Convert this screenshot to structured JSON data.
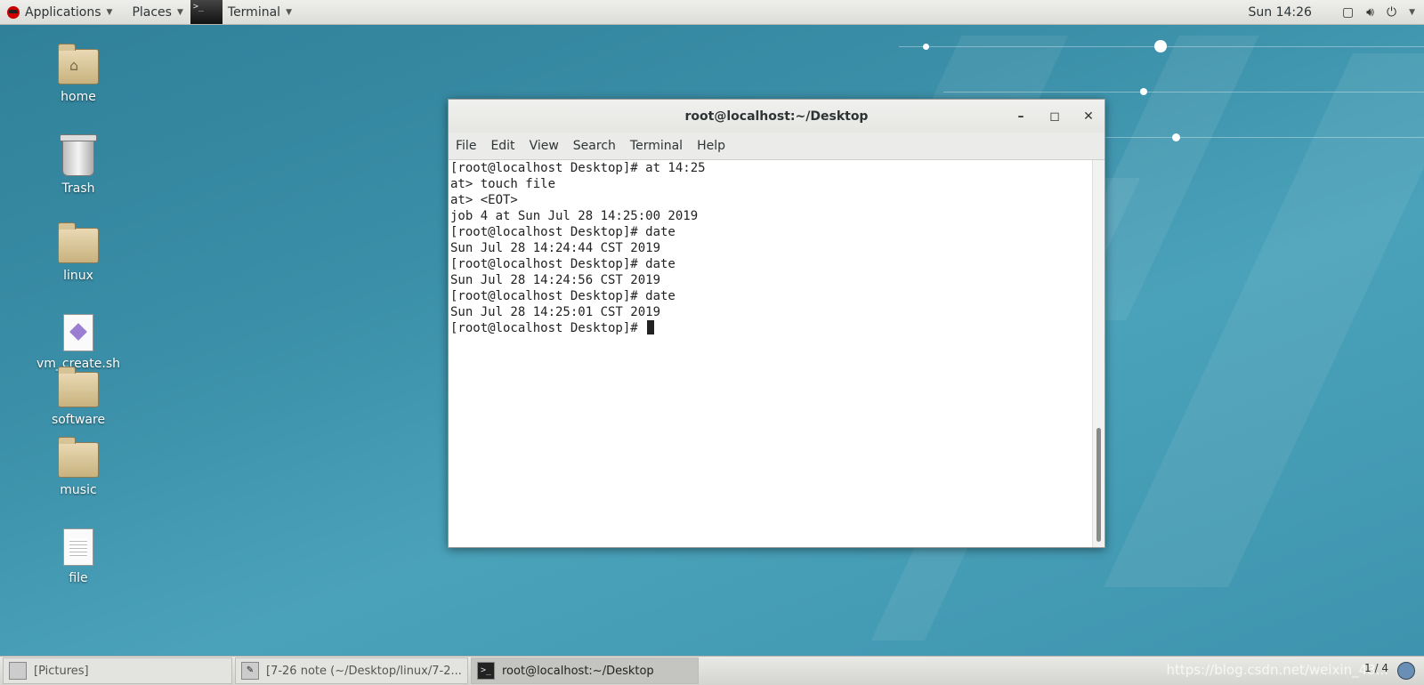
{
  "top_panel": {
    "applications": "Applications",
    "places": "Places",
    "terminal": "Terminal",
    "clock": "Sun 14:26",
    "icons": [
      "screen-icon",
      "volume-icon",
      "power-icon"
    ]
  },
  "desktop_icons": [
    {
      "label": "home"
    },
    {
      "label": "Trash"
    },
    {
      "label": "linux"
    },
    {
      "label": "vm_create.sh"
    },
    {
      "label": "software"
    },
    {
      "label": "music"
    },
    {
      "label": "file"
    }
  ],
  "terminal": {
    "title": "root@localhost:~/Desktop",
    "menu": [
      "File",
      "Edit",
      "View",
      "Search",
      "Terminal",
      "Help"
    ],
    "lines": [
      "[root@localhost Desktop]# at 14:25",
      "at> touch file",
      "at> <EOT>",
      "job 4 at Sun Jul 28 14:25:00 2019",
      "[root@localhost Desktop]# date",
      "Sun Jul 28 14:24:44 CST 2019",
      "[root@localhost Desktop]# date",
      "Sun Jul 28 14:24:56 CST 2019",
      "[root@localhost Desktop]# date",
      "Sun Jul 28 14:25:01 CST 2019",
      "[root@localhost Desktop]# "
    ]
  },
  "taskbar": {
    "items": [
      {
        "label": "[Pictures]"
      },
      {
        "label": "[7-26 note (~/Desktop/linux/7-2..."
      },
      {
        "label": "root@localhost:~/Desktop"
      }
    ],
    "workspace": "1 / 4",
    "watermark": "https://blog.csdn.net/weixin_43..."
  }
}
